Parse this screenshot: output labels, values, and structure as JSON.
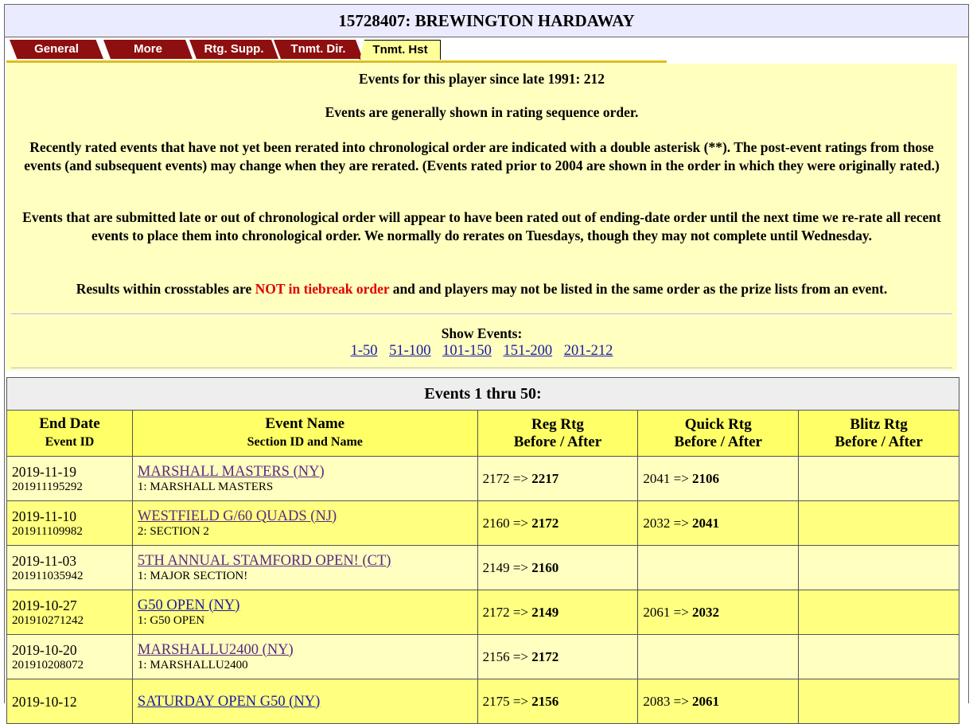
{
  "player": {
    "title": "15728407: BREWINGTON HARDAWAY"
  },
  "tabs": [
    {
      "label": "General"
    },
    {
      "label": "More"
    },
    {
      "label": "Rtg. Supp."
    },
    {
      "label": "Tnmt. Dir."
    },
    {
      "label": "Tnmt. Hst"
    }
  ],
  "info": {
    "events_count": "Events for this player since late 1991: 212",
    "sequence_note": "Events are generally shown in rating sequence order.",
    "rerate_note": "Recently rated events that have not yet been rerated into chronological order are indicated with a double asterisk (**). The post-event ratings from those events (and subsequent events) may change when they are rerated. (Events rated prior to 2004 are shown in the order in which they were originally rated.)",
    "late_note": "Events that are submitted late or out of chronological order will appear to have been rated out of ending-date order until the next time we re-rate all recent events to place them into chronological order. We normally do rerates on Tuesdays, though they may not complete until Wednesday.",
    "crosstable_pre": "Results within crosstables are ",
    "crosstable_red": "NOT in tiebreak order",
    "crosstable_post": " and and players may not be listed in the same order as the prize lists from an event."
  },
  "show_events": {
    "label": "Show Events:",
    "links": [
      "1-50",
      "51-100",
      "101-150",
      "151-200",
      "201-212"
    ]
  },
  "table": {
    "caption": "Events 1 thru 50:",
    "headers": [
      {
        "main": "End Date",
        "sub": "Event ID"
      },
      {
        "main": "Event Name",
        "sub": "Section ID and Name"
      },
      {
        "main": "Reg Rtg",
        "sub": "Before / After"
      },
      {
        "main": "Quick Rtg",
        "sub": "Before / After"
      },
      {
        "main": "Blitz Rtg",
        "sub": "Before / After"
      }
    ],
    "rows": [
      {
        "date": "2019-11-19",
        "id": "201911195292",
        "name": "MARSHALL MASTERS (NY)",
        "section": "1: MARSHALL MASTERS",
        "reg_before": "2172 =>",
        "reg_after": "2217",
        "quick_before": "2041 =>",
        "quick_after": "2106",
        "blitz_before": "",
        "blitz_after": ""
      },
      {
        "date": "2019-11-10",
        "id": "201911109982",
        "name": "WESTFIELD G/60 QUADS (NJ)",
        "section": "2: SECTION 2",
        "reg_before": "2160 =>",
        "reg_after": "2172",
        "quick_before": "2032 =>",
        "quick_after": "2041",
        "blitz_before": "",
        "blitz_after": ""
      },
      {
        "date": "2019-11-03",
        "id": "201911035942",
        "name": "5TH ANNUAL STAMFORD OPEN! (CT)",
        "section": "1: MAJOR SECTION!",
        "reg_before": "2149 =>",
        "reg_after": "2160",
        "quick_before": "",
        "quick_after": "",
        "blitz_before": "",
        "blitz_after": ""
      },
      {
        "date": "2019-10-27",
        "id": "201910271242",
        "name": "G50 OPEN (NY)",
        "section": "1: G50 OPEN",
        "reg_before": "2172 =>",
        "reg_after": "2149",
        "quick_before": "2061 =>",
        "quick_after": "2032",
        "blitz_before": "",
        "blitz_after": ""
      },
      {
        "date": "2019-10-20",
        "id": "201910208072",
        "name": "MARSHALLU2400 (NY)",
        "section": "1: MARSHALLU2400",
        "reg_before": "2156 =>",
        "reg_after": "2172",
        "quick_before": "",
        "quick_after": "",
        "blitz_before": "",
        "blitz_after": ""
      },
      {
        "date": "2019-10-12",
        "id": "",
        "name": "SATURDAY OPEN G50 (NY)",
        "section": "",
        "reg_before": "2175 =>",
        "reg_after": "2156",
        "quick_before": "2083 =>",
        "quick_after": "2061",
        "blitz_before": "",
        "blitz_after": ""
      }
    ]
  }
}
